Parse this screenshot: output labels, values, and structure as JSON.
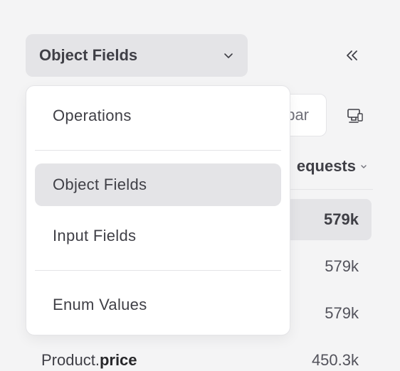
{
  "selector": {
    "label": "Object Fields",
    "icon": "chevron-down-icon"
  },
  "collapse": {
    "icon": "double-chevron-left-icon"
  },
  "search": {
    "partial_text": "bar"
  },
  "device": {
    "icon": "monitor-icon"
  },
  "table": {
    "header_label": "equests",
    "rows": [
      {
        "value": "579k"
      },
      {
        "value": "579k"
      },
      {
        "value": "579k"
      },
      {
        "type": "Product.",
        "field": "price",
        "value": "450.3k"
      }
    ]
  },
  "menu": {
    "items": [
      {
        "label": "Operations"
      },
      {
        "label": "Object Fields"
      },
      {
        "label": "Input Fields"
      },
      {
        "label": "Enum Values"
      }
    ],
    "active_index": 1
  },
  "colors": {
    "background": "#f4f4f5",
    "selected": "#e4e4e7",
    "text": "#3f3f46"
  }
}
